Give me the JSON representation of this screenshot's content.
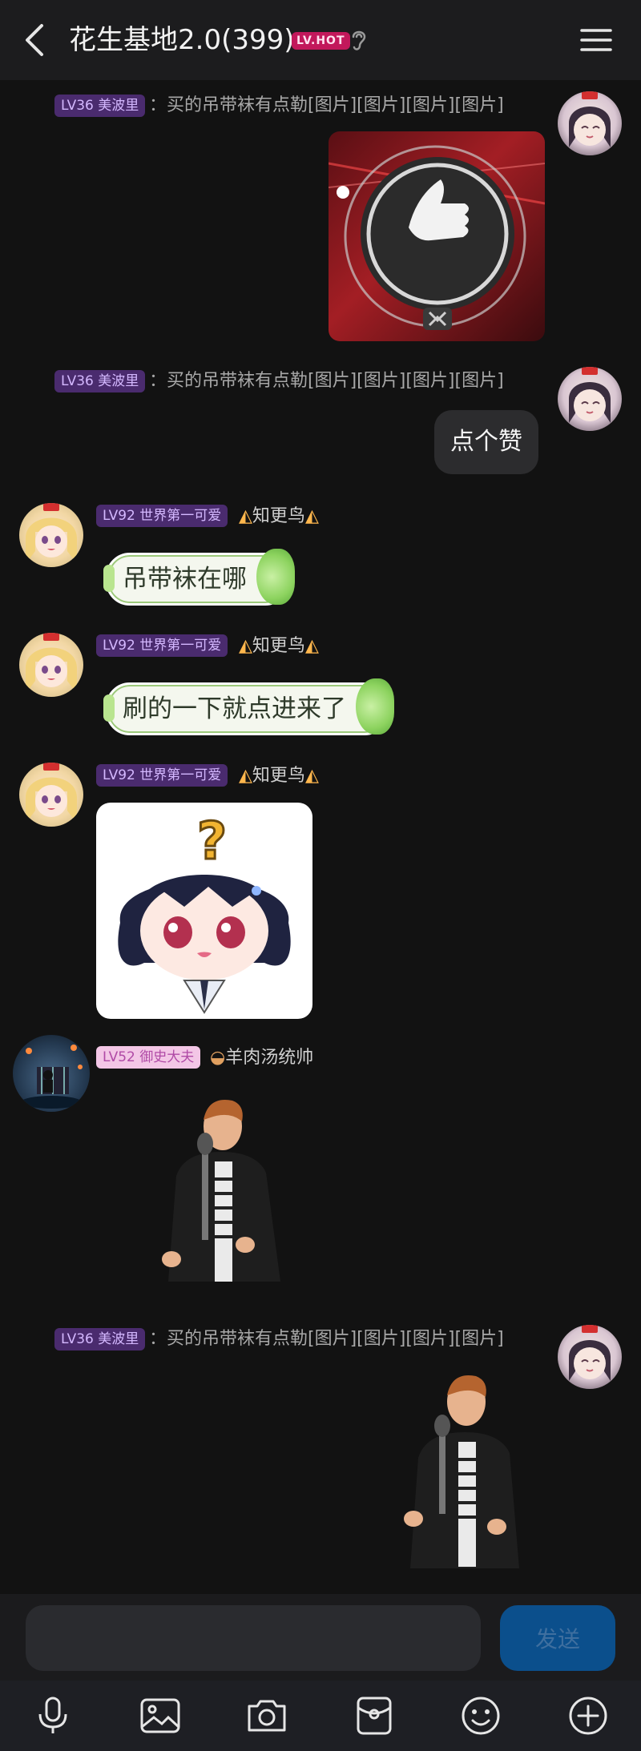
{
  "header": {
    "title": "花生基地2.0(399)",
    "badge": "LV.HOT"
  },
  "messages": [
    {
      "level": "LV36 美波里",
      "text": "：买的吊带袜有点勒[图片][图片][图片][图片]"
    },
    {
      "level": "LV36 美波里",
      "text": "：买的吊带袜有点勒[图片][图片][图片][图片]",
      "bubble": "点个赞"
    },
    {
      "level": "LV92 世界第一可爱",
      "nick": "知更鸟",
      "bubble": "吊带袜在哪"
    },
    {
      "level": "LV92 世界第一可爱",
      "nick": "知更鸟",
      "bubble": "刷的一下就点进来了"
    },
    {
      "level": "LV92 世界第一可爱",
      "nick": "知更鸟",
      "sticker_mark": "?"
    },
    {
      "level": "LV52 御史大夫",
      "nick": "羊肉汤统帅"
    },
    {
      "level": "LV36 美波里",
      "text": "：买的吊带袜有点勒[图片][图片][图片][图片]"
    }
  ],
  "input": {
    "placeholder": "",
    "send_label": "发送"
  },
  "icons": {
    "back": "chevron-left-icon",
    "menu": "hamburger-menu-icon",
    "ear": "ear-icon",
    "toolbar": [
      "microphone-icon",
      "image-icon",
      "camera-icon",
      "red-packet-icon",
      "emoji-icon",
      "plus-circle-icon"
    ]
  },
  "colors": {
    "background": "#121212",
    "header": "#1c1c1e",
    "send_button": "#0b4f8c",
    "level_purple": "#4a2b6e"
  }
}
